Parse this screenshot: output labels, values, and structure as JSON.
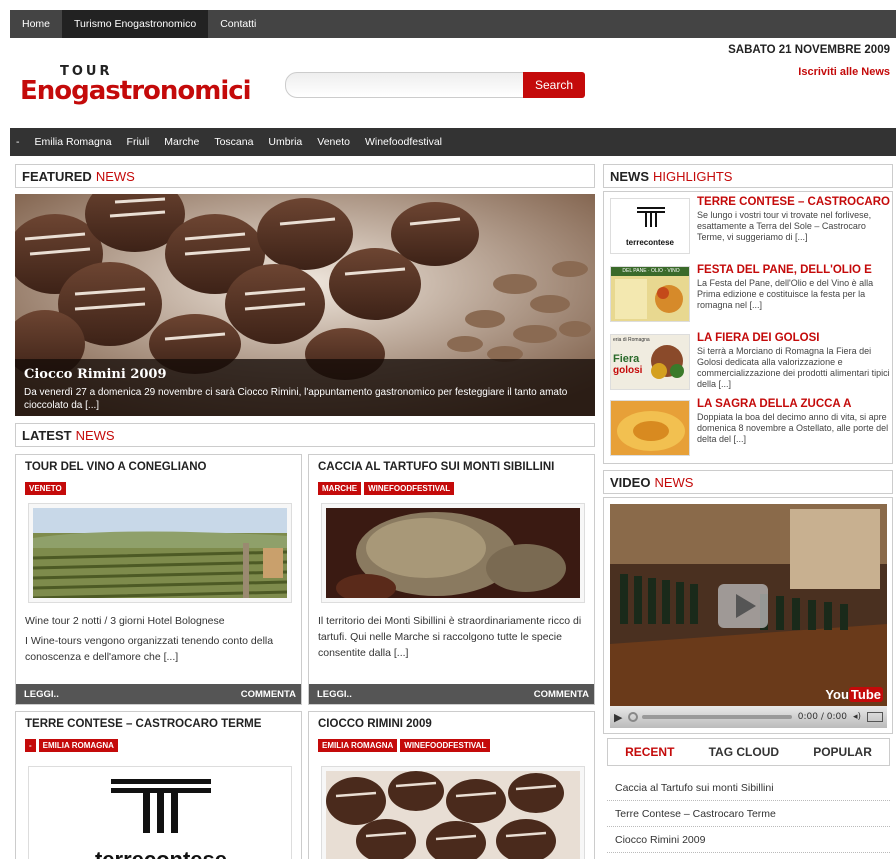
{
  "topnav": {
    "items": [
      "Home",
      "Turismo Enogastronomico",
      "Contatti"
    ],
    "active": "Turismo Enogastronomico"
  },
  "header": {
    "date": "SABATO 21 NOVEMBRE 2009",
    "subscribe": "Iscriviti alle News",
    "logo_top": "TOUR",
    "logo_main": "Enogastronomici"
  },
  "search": {
    "placeholder": "",
    "button": "Search"
  },
  "categories": [
    "-",
    "Emilia Romagna",
    "Friuli",
    "Marche",
    "Toscana",
    "Umbria",
    "Veneto",
    "Winefoodfestival"
  ],
  "featured": {
    "head_bold": "FEATURED",
    "head_red": "NEWS",
    "title": "Ciocco Rimini 2009",
    "desc": "Da venerdì 27 a domenica 29 novembre ci sarà Ciocco Rimini, l'appuntamento gastronomico per festeggiare il tanto amato cioccolato da [...]"
  },
  "latest": {
    "head_bold": "LATEST",
    "head_red": "NEWS",
    "cards": [
      {
        "title": "TOUR DEL VINO A CONEGLIANO",
        "tags": [
          "VENETO"
        ],
        "ex1": "Wine tour 2 notti / 3 giorni Hotel Bolognese",
        "ex2": "I Wine-tours vengono organizzati tenendo conto della conoscenza e dell'amore che [...]",
        "more": "LEGGI..",
        "comment": "COMMENTA"
      },
      {
        "title": "CACCIA AL TARTUFO SUI MONTI SIBILLINI",
        "tags": [
          "MARCHE",
          "WINEFOODFESTIVAL"
        ],
        "ex1": "Il territorio dei Monti Sibillini è straordinariamente ricco di tartufi. Qui nelle Marche si raccolgono tutte le specie consentite dalla [...]",
        "ex2": "",
        "more": "LEGGI..",
        "comment": "COMMENTA"
      },
      {
        "title": "TERRE CONTESE – CASTROCARO TERME",
        "tags": [
          "-",
          "EMILIA ROMAGNA"
        ]
      },
      {
        "title": "CIOCCO RIMINI 2009",
        "tags": [
          "EMILIA ROMAGNA",
          "WINEFOODFESTIVAL"
        ]
      }
    ]
  },
  "highlights": {
    "head_bold": "NEWS",
    "head_red": "HIGHLIGHTS",
    "items": [
      {
        "title": "TERRE CONTESE – CASTROCARO",
        "desc": "Se lungo i vostri tour vi trovate nel forlivese, esattamente a Terra del Sole – Castrocaro Terme, vi suggeriamo di [...]"
      },
      {
        "title": "FESTA DEL PANE, DELL'OLIO E",
        "desc": "La Festa del Pane, dell'Olio e del Vino è alla Prima edizione e costituisce la festa per la romagna nel [...]"
      },
      {
        "title": "LA FIERA DEI GOLOSI",
        "desc": "Si terrà a Morciano di Romagna la Fiera dei Golosi dedicata alla valorizzazione e commercializzazione dei prodotti alimentari tipici della [...]"
      },
      {
        "title": "LA SAGRA DELLA ZUCCA A",
        "desc": "Doppiata la boa del decimo anno di vita, si apre domenica 8 novembre a Ostellato, alle porte del delta del [...]"
      }
    ]
  },
  "thumb_texts": {
    "terrecontese": "terrecontese",
    "fiera": "Fiera",
    "golosi": "golosi",
    "fiera_top": "eria di Romagna",
    "festa_top": "DEL PANE · OLIO · VINO"
  },
  "video": {
    "head_bold": "VIDEO",
    "head_red": "NEWS",
    "time": "0:00 / 0:00",
    "brand_you": "You",
    "brand_tube": "Tube"
  },
  "sidetabs": [
    "RECENT",
    "TAG CLOUD",
    "POPULAR"
  ],
  "recent": [
    "Caccia al Tartufo sui monti Sibillini",
    "Terre Contese – Castrocaro Terme",
    "Ciocco Rimini 2009"
  ],
  "colors": {
    "accent": "#c40a0a",
    "dark": "#333333"
  }
}
